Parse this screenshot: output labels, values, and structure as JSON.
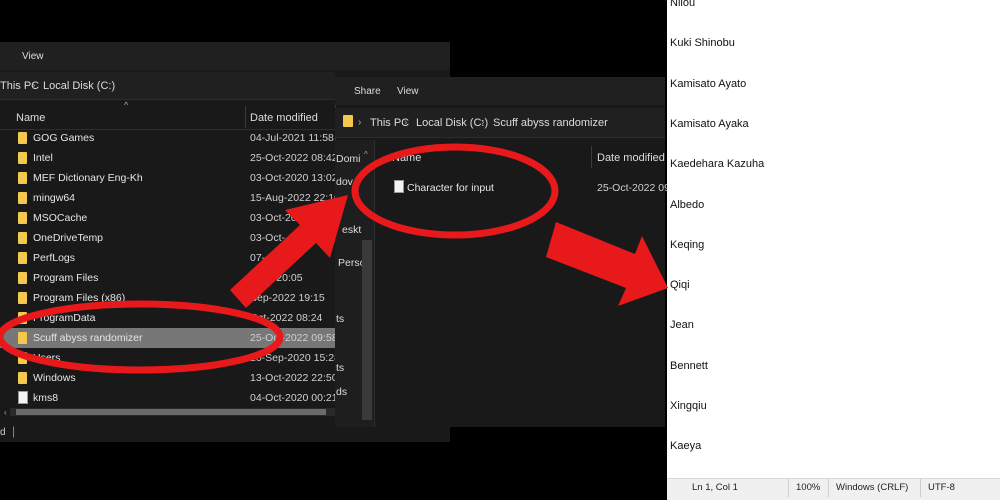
{
  "explorer1": {
    "menu": {
      "view": "View"
    },
    "breadcrumb": [
      "This PC",
      "Local Disk (C:)"
    ],
    "columns": {
      "name": "Name",
      "date": "Date modified"
    },
    "files": [
      {
        "name": "GOG Games",
        "date": "04-Jul-2021 11:58",
        "type": "folder"
      },
      {
        "name": "Intel",
        "date": "25-Oct-2022 08:42",
        "type": "folder"
      },
      {
        "name": "MEF Dictionary Eng-Kh",
        "date": "03-Oct-2020 13:02",
        "type": "folder"
      },
      {
        "name": "mingw64",
        "date": "15-Aug-2022 22:10",
        "type": "folder"
      },
      {
        "name": "MSOCache",
        "date": "03-Oct-2020",
        "type": "folder"
      },
      {
        "name": "OneDriveTemp",
        "date": "03-Oct-",
        "type": "folder"
      },
      {
        "name": "PerfLogs",
        "date": "07-",
        "type": "folder"
      },
      {
        "name": "Program Files",
        "date": "2022 20:05",
        "type": "folder"
      },
      {
        "name": "Program Files (x86)",
        "date": "Sep-2022 19:15",
        "type": "folder"
      },
      {
        "name": "ProgramData",
        "date": "Oct-2022 08:24",
        "type": "folder"
      },
      {
        "name": "Scuff abyss randomizer",
        "date": "25-Oct-2022 09:58",
        "type": "folder",
        "selected": true
      },
      {
        "name": "Users",
        "date": "20-Sep-2020 15:28",
        "type": "folder"
      },
      {
        "name": "Windows",
        "date": "13-Oct-2022 22:50",
        "type": "folder"
      },
      {
        "name": "kms8",
        "date": "04-Oct-2020 00:21",
        "type": "file"
      }
    ],
    "status": "d"
  },
  "explorer2": {
    "menu": {
      "share": "Share",
      "view": "View"
    },
    "breadcrumb": [
      "This PC",
      "Local Disk (C:)",
      "Scuff abyss randomizer"
    ],
    "nav": [
      "Domi",
      "dov",
      "eskt",
      "Perso",
      "ts",
      "ts",
      "ds"
    ],
    "columns": {
      "name": "Name",
      "date": "Date modified"
    },
    "file": {
      "name": "Character for input",
      "date": "25-Oct-2022 09:5"
    }
  },
  "notepad": {
    "lines": [
      "Nilou",
      "Kuki Shinobu",
      "Kamisato Ayato",
      "Kamisato Ayaka",
      "Kaedehara Kazuha",
      "Albedo",
      "Keqing",
      "Qiqi",
      "Jean",
      "Bennett",
      "Xingqiu",
      "Kaeya"
    ],
    "status": {
      "position": "Ln 1, Col 1",
      "zoom": "100%",
      "line_ending": "Windows (CRLF)",
      "encoding": "UTF-8"
    }
  },
  "colors": {
    "annotation": "#e8191b",
    "selection": "#777777",
    "folder": "#f2c94c"
  }
}
